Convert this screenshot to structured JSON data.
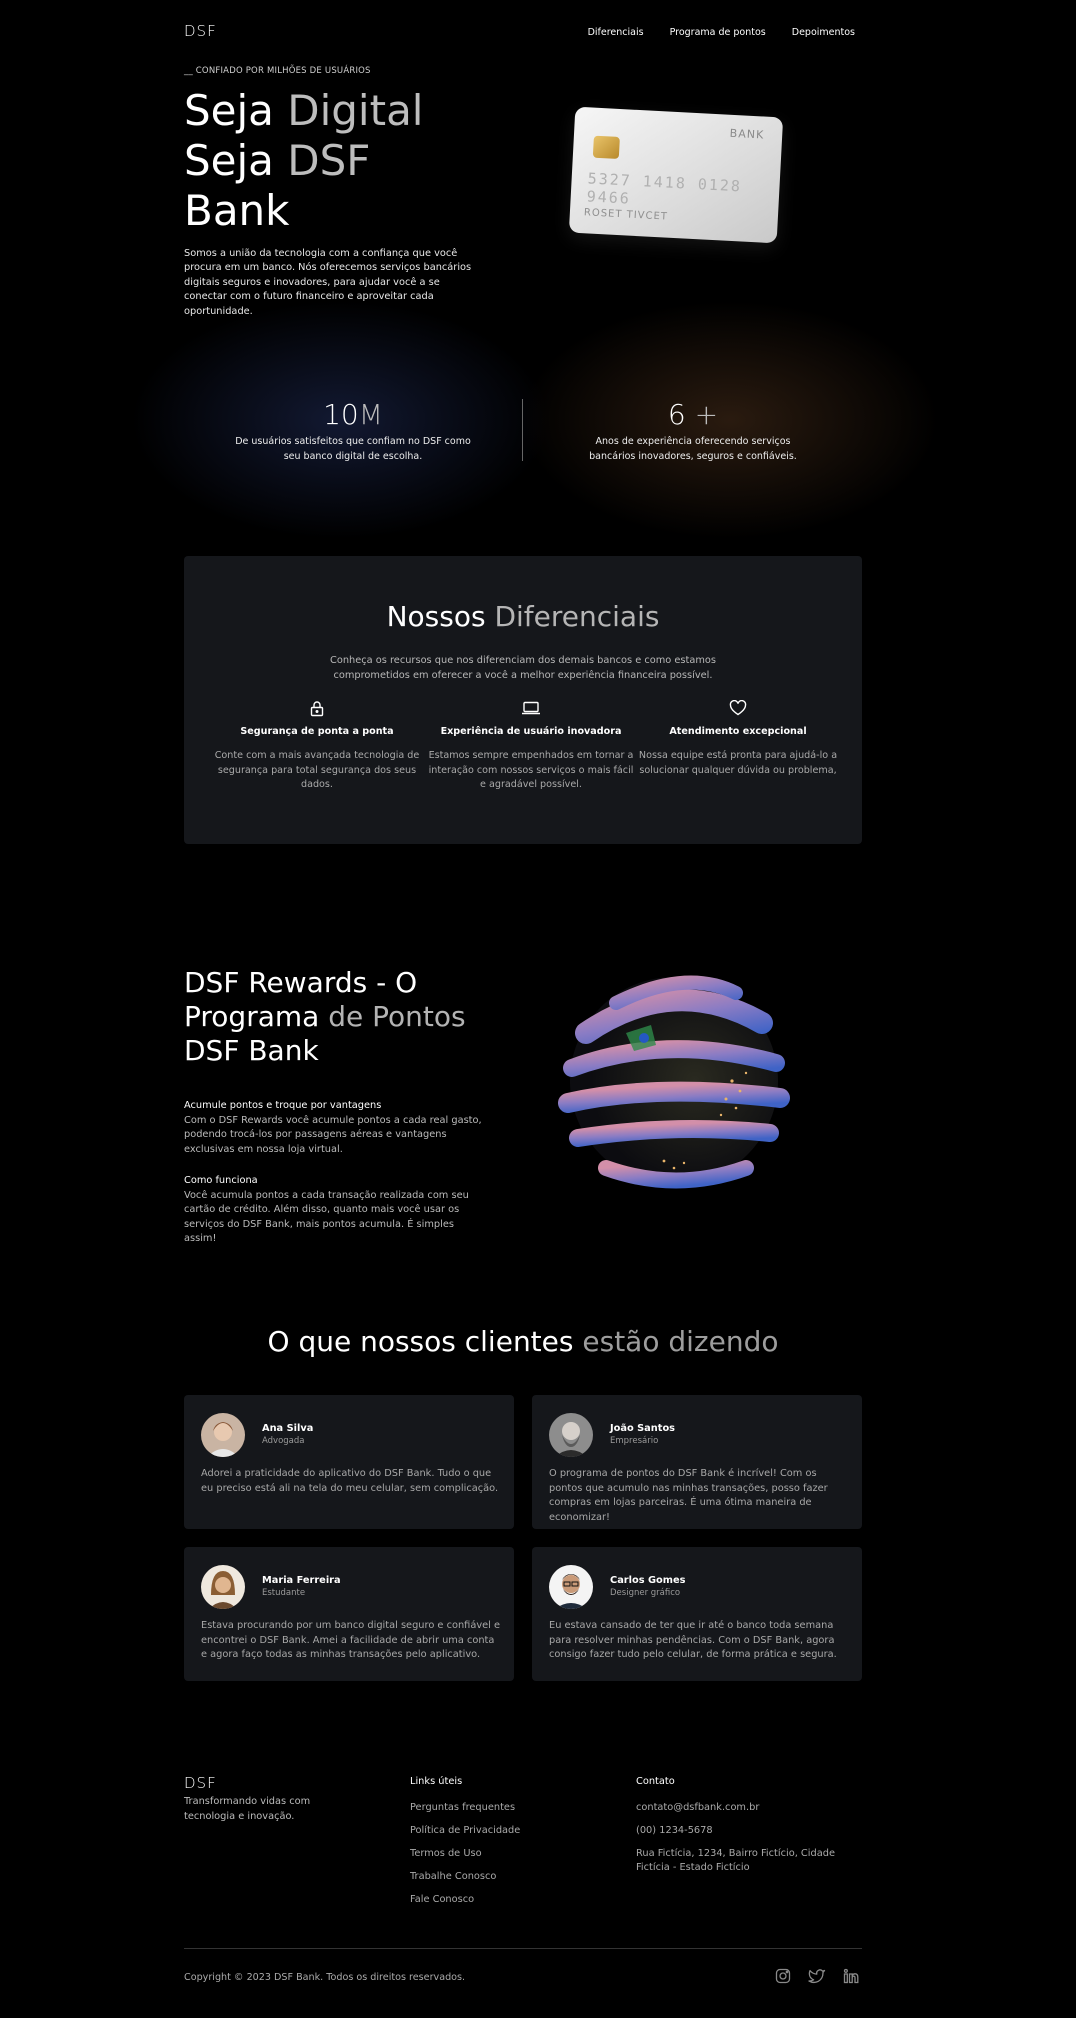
{
  "header": {
    "logo": "DSF",
    "nav": [
      "Diferenciais",
      "Programa de pontos",
      "Depoimentos"
    ]
  },
  "hero": {
    "kicker": "__ CONFIADO POR MILHÕES DE USUÁRIOS",
    "title_line1_a": "Seja ",
    "title_line1_b": "Digital",
    "title_line2_a": "Seja ",
    "title_line2_b": "DSF",
    "title_line3": "Bank",
    "description": "Somos a união da tecnologia com a confiança que você procura em um banco. Nós oferecemos serviços bancários digitais seguros e inovadores, para ajudar você a se conectar com o futuro financeiro e aproveitar cada oportunidade.",
    "card": {
      "bank": "BANK",
      "number": "5327 1418 0128 9466",
      "holder": "ROSET TIVCET"
    }
  },
  "stats": [
    {
      "value": "10",
      "suffix": "M",
      "text": "De usuários satisfeitos que confiam no DSF como seu banco digital de escolha."
    },
    {
      "value": "6",
      "suffix": " +",
      "text": "Anos de experiência oferecendo serviços bancários inovadores, seguros e confiáveis."
    }
  ],
  "diferenciais": {
    "title_a": "Nossos ",
    "title_b": "Diferenciais",
    "subtitle": "Conheça os recursos que nos diferenciam dos demais bancos e como estamos comprometidos em oferecer a você a melhor experiência financeira possível.",
    "features": [
      {
        "icon": "lock-icon",
        "title": "Segurança de ponta a ponta",
        "text": "Conte com a mais avançada tecnologia de segurança para total segurança dos seus dados."
      },
      {
        "icon": "laptop-icon",
        "title": "Experiência de usuário inovadora",
        "text": "Estamos sempre empenhados em tornar a interação com nossos serviços o mais fácil e agradável possível."
      },
      {
        "icon": "heart-icon",
        "title": "Atendimento excepcional",
        "text": "Nossa equipe está pronta para ajudá-lo a solucionar qualquer dúvida ou problema,"
      }
    ]
  },
  "rewards": {
    "title_a": "DSF Rewards - O Programa",
    "title_b": " de Pontos",
    "title_c": "DSF Bank",
    "blocks": [
      {
        "heading": "Acumule pontos e troque por vantagens",
        "text": "Com o DSF Rewards você acumule pontos a cada real gasto, podendo trocá-los por passagens aéreas e vantagens exclusivas em nossa loja virtual."
      },
      {
        "heading": "Como funciona",
        "text": "Você acumula pontos a cada transação realizada com seu cartão de crédito. Além disso, quanto mais você usar os serviços do DSF Bank, mais pontos acumula. É simples assim!"
      }
    ]
  },
  "testimonials": {
    "title_a": "O que nossos clientes",
    "title_b": " estão dizendo",
    "items": [
      {
        "name": "Ana Silva",
        "role": "Advogada",
        "quote": "Adorei a praticidade do aplicativo do DSF Bank. Tudo o que eu preciso está ali na tela do meu celular, sem complicação."
      },
      {
        "name": "João Santos",
        "role": "Empresário",
        "quote": "O programa de pontos do DSF Bank é incrível! Com os pontos que acumulo nas minhas transações, posso fazer compras em lojas parceiras. É uma ótima maneira de economizar!"
      },
      {
        "name": "Maria Ferreira",
        "role": "Estudante",
        "quote": "Estava procurando por um banco digital seguro e confiável e encontrei o DSF Bank. Amei a facilidade de abrir uma conta e agora faço todas as minhas transações pelo aplicativo."
      },
      {
        "name": "Carlos Gomes",
        "role": "Designer gráfico",
        "quote": "Eu estava cansado de ter que ir até o banco toda semana para resolver minhas pendências. Com o DSF Bank, agora consigo fazer tudo pelo celular, de forma prática e segura."
      }
    ]
  },
  "footer": {
    "logo": "DSF",
    "tagline": "Transformando vidas com tecnologia e inovação.",
    "links_title": "Links úteis",
    "links": [
      "Perguntas frequentes",
      "Política de Privacidade",
      "Termos de Uso",
      "Trabalhe Conosco",
      "Fale Conosco"
    ],
    "contact_title": "Contato",
    "contact": [
      "contato@dsfbank.com.br",
      "(00) 1234-5678",
      "Rua Fictícia, 1234, Bairro Fictício, Cidade Fictícia - Estado Fictício"
    ],
    "copyright": "Copyright © 2023 DSF Bank. Todos os direitos reservados.",
    "social": [
      "instagram-icon",
      "twitter-icon",
      "linkedin-icon"
    ]
  }
}
